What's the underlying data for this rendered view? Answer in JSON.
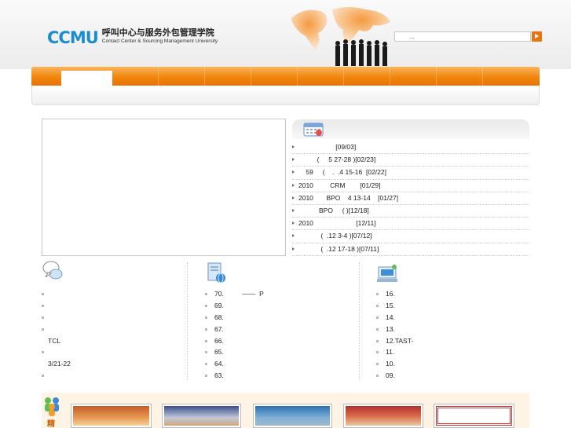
{
  "header": {
    "logo_mark": "CCMU",
    "logo_title": "呼叫中心与服务外包管理学院",
    "logo_subtitle": "Contact Center & Sourcing Management University",
    "search_placeholder": "..."
  },
  "news": {
    "items": [
      "                    [09/03]",
      "          (     5 27-28 )[02/23]",
      "    59     (    .  .4 15-16  [02/22]",
      "2010         CRM        [01/29]",
      "2010       BPO    4 13-14    [01/27]",
      "           BPO     ( )[12/18]",
      "2010                       [12/11]",
      "            (  .12 3-4 )[07/12]",
      "            (  .12 17-18 )[07/11]"
    ]
  },
  "col1": {
    "items": [
      "",
      "",
      "",
      "",
      "TCL",
      "",
      "3/21-22",
      ""
    ]
  },
  "col2": {
    "items": [
      "70.          ——  P",
      "69.",
      "68.",
      "67.",
      "66.",
      "65.",
      "64.",
      "63."
    ]
  },
  "col3": {
    "items": [
      "16.",
      "15.",
      "14.",
      "13.",
      "12.TAST-",
      "11.",
      "10.",
      "09."
    ]
  },
  "bottom": {
    "label": "精"
  },
  "colors": {
    "accent": "#f0860d",
    "brand": "#1a8dd0"
  }
}
